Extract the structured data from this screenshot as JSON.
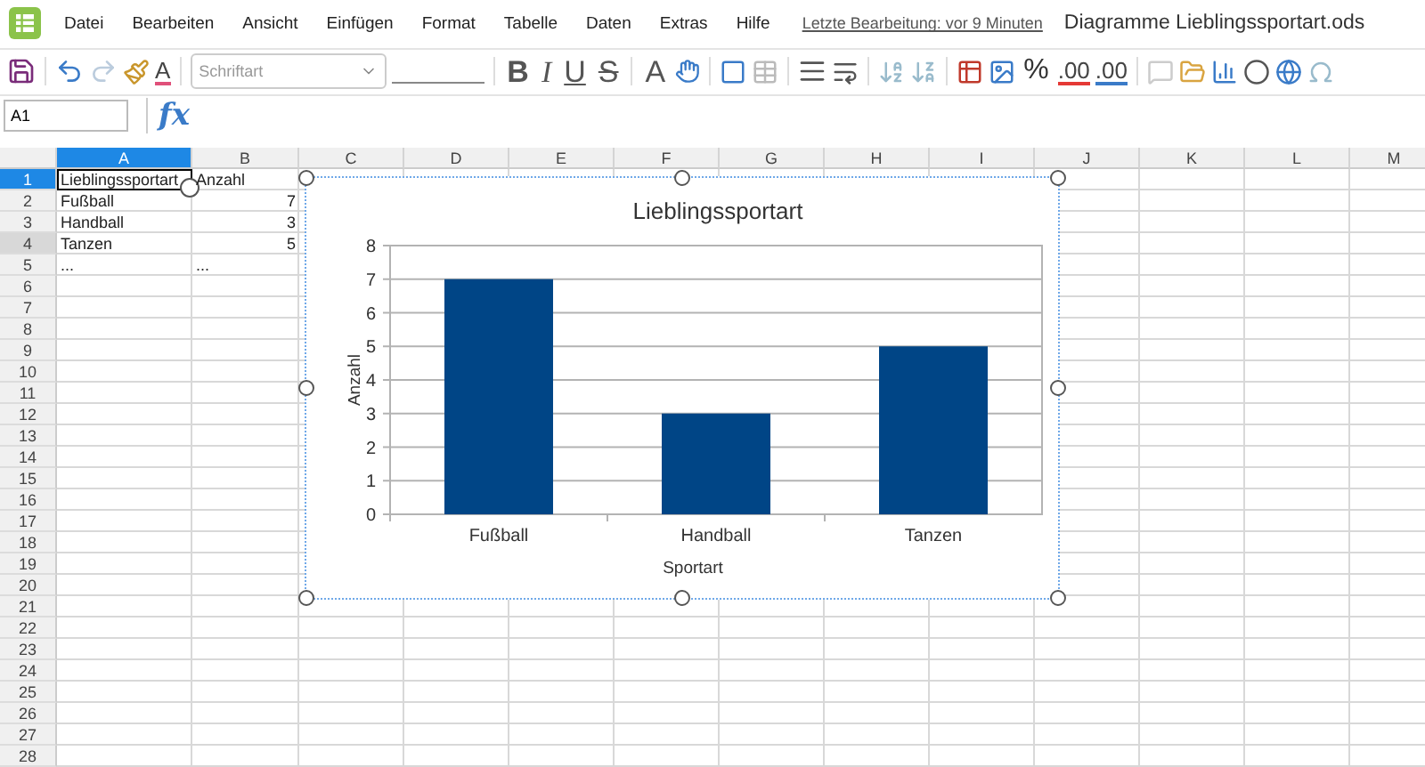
{
  "menu": {
    "items": [
      "Datei",
      "Bearbeiten",
      "Ansicht",
      "Einfügen",
      "Format",
      "Tabelle",
      "Daten",
      "Extras",
      "Hilfe"
    ],
    "last_edit": "Letzte Bearbeitung: vor 9 Minuten",
    "document_title": "Diagramme Lieblingssportart.ods"
  },
  "toolbar": {
    "font_placeholder": "Schriftart",
    "glyphs": [
      "A",
      "B",
      "I",
      "U",
      "S",
      "A",
      "%",
      ".00",
      ".00"
    ]
  },
  "formula_bar": {
    "cell_ref": "A1",
    "fx": "fx"
  },
  "columns": [
    {
      "label": "A",
      "selected": true
    },
    {
      "label": "B",
      "selected": false
    },
    {
      "label": "C",
      "selected": false
    },
    {
      "label": "D",
      "selected": false
    },
    {
      "label": "E",
      "selected": false
    },
    {
      "label": "F",
      "selected": false
    },
    {
      "label": "G",
      "selected": false
    },
    {
      "label": "H",
      "selected": false
    },
    {
      "label": "I",
      "selected": false
    },
    {
      "label": "J",
      "selected": false
    },
    {
      "label": "K",
      "selected": false
    },
    {
      "label": "L",
      "selected": false
    },
    {
      "label": "M",
      "selected": false
    }
  ],
  "rows": [
    {
      "label": "1",
      "selected": true,
      "cells": [
        {
          "text": "Lieblingssportart",
          "kind": "text",
          "active": true
        },
        {
          "text": "Anzahl",
          "kind": "text",
          "active": false
        }
      ]
    },
    {
      "label": "2",
      "selected": false,
      "cells": [
        {
          "text": "Fußball",
          "kind": "text",
          "active": false
        },
        {
          "text": "7",
          "kind": "number",
          "active": false
        }
      ]
    },
    {
      "label": "3",
      "selected": false,
      "cells": [
        {
          "text": "Handball",
          "kind": "text",
          "active": false
        },
        {
          "text": "3",
          "kind": "number",
          "active": false
        }
      ]
    },
    {
      "label": "4",
      "selected": false,
      "hover": true,
      "cells": [
        {
          "text": "Tanzen",
          "kind": "text",
          "active": false
        },
        {
          "text": "5",
          "kind": "number",
          "active": false
        }
      ]
    },
    {
      "label": "5",
      "selected": false,
      "cells": [
        {
          "text": "...",
          "kind": "text",
          "active": false
        },
        {
          "text": "...",
          "kind": "text",
          "active": false
        }
      ]
    },
    {
      "label": "6",
      "selected": false
    },
    {
      "label": "7",
      "selected": false
    },
    {
      "label": "8",
      "selected": false
    },
    {
      "label": "9",
      "selected": false
    },
    {
      "label": "10",
      "selected": false
    },
    {
      "label": "11",
      "selected": false
    },
    {
      "label": "12",
      "selected": false
    },
    {
      "label": "13",
      "selected": false
    },
    {
      "label": "14",
      "selected": false
    },
    {
      "label": "15",
      "selected": false
    },
    {
      "label": "16",
      "selected": false
    },
    {
      "label": "17",
      "selected": false
    },
    {
      "label": "18",
      "selected": false
    },
    {
      "label": "19",
      "selected": false
    },
    {
      "label": "20",
      "selected": false
    },
    {
      "label": "21",
      "selected": false
    },
    {
      "label": "22",
      "selected": false
    },
    {
      "label": "23",
      "selected": false
    },
    {
      "label": "24",
      "selected": false
    },
    {
      "label": "25",
      "selected": false
    },
    {
      "label": "26",
      "selected": false
    },
    {
      "label": "27",
      "selected": false
    },
    {
      "label": "28",
      "selected": false
    }
  ],
  "chart": {
    "selected": true,
    "chart_data": {
      "type": "bar",
      "title": "Lieblingssportart",
      "xlabel": "Sportart",
      "ylabel": "Anzahl",
      "categories": [
        "Fußball",
        "Handball",
        "Tanzen"
      ],
      "series": [
        {
          "color": "#004586",
          "values": [
            7,
            3,
            5
          ]
        }
      ],
      "ylim": [
        0,
        8
      ],
      "yticks": [
        0,
        1,
        2,
        3,
        4,
        5,
        6,
        7,
        8
      ],
      "grid": true
    }
  }
}
